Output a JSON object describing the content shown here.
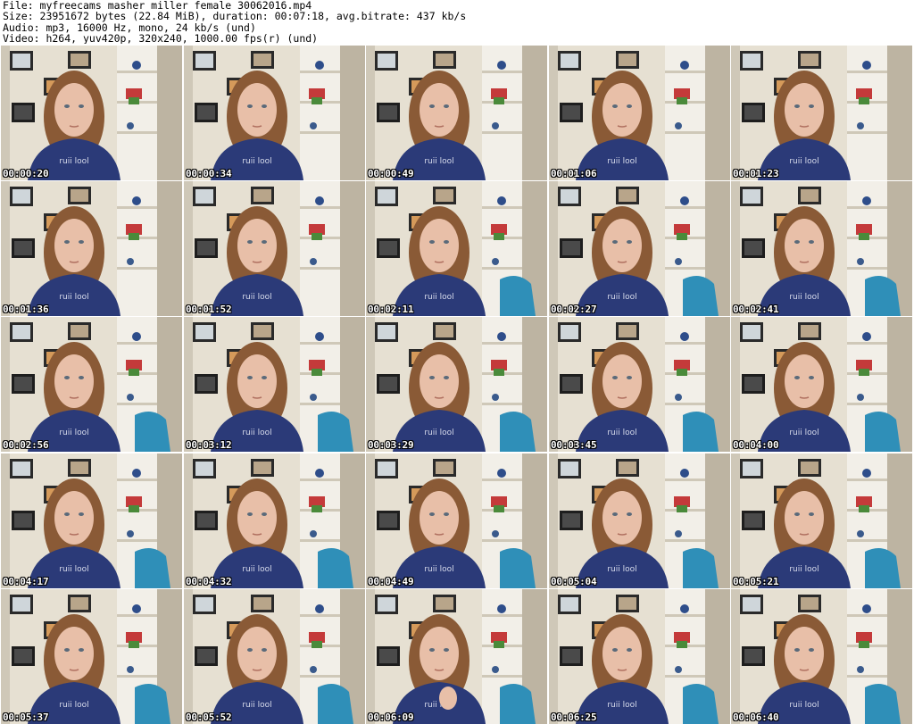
{
  "header": {
    "file_line": "File: myfreecams_masher_miller_female_30062016.mp4",
    "size_line": "Size: 23951672 bytes (22.84 MiB), duration: 00:07:18, avg.bitrate: 437 kb/s",
    "audio_line": "Audio: mp3, 16000 Hz, mono, 24 kb/s (und)",
    "video_line": "Video: h264, yuv420p, 320x240, 1000.00 fps(r) (und)"
  },
  "thumbnails": [
    {
      "timestamp": "00:00:20"
    },
    {
      "timestamp": "00:00:34"
    },
    {
      "timestamp": "00:00:49"
    },
    {
      "timestamp": "00:01:06"
    },
    {
      "timestamp": "00:01:23"
    },
    {
      "timestamp": "00:01:36"
    },
    {
      "timestamp": "00:01:52"
    },
    {
      "timestamp": "00:02:11"
    },
    {
      "timestamp": "00:02:27"
    },
    {
      "timestamp": "00:02:41"
    },
    {
      "timestamp": "00:02:56"
    },
    {
      "timestamp": "00:03:12"
    },
    {
      "timestamp": "00:03:29"
    },
    {
      "timestamp": "00:03:45"
    },
    {
      "timestamp": "00:04:00"
    },
    {
      "timestamp": "00:04:17"
    },
    {
      "timestamp": "00:04:32"
    },
    {
      "timestamp": "00:04:49"
    },
    {
      "timestamp": "00:05:04"
    },
    {
      "timestamp": "00:05:21"
    },
    {
      "timestamp": "00:05:37"
    },
    {
      "timestamp": "00:05:52"
    },
    {
      "timestamp": "00:06:09"
    },
    {
      "timestamp": "00:06:25"
    },
    {
      "timestamp": "00:06:40"
    }
  ],
  "colors": {
    "wall": "#e6e0d2",
    "shelf": "#f2efe8",
    "shirt": "#2b3a78",
    "hair": "#8a5a36",
    "skin": "#e8bfa8",
    "chair": "#2f8fb8"
  }
}
